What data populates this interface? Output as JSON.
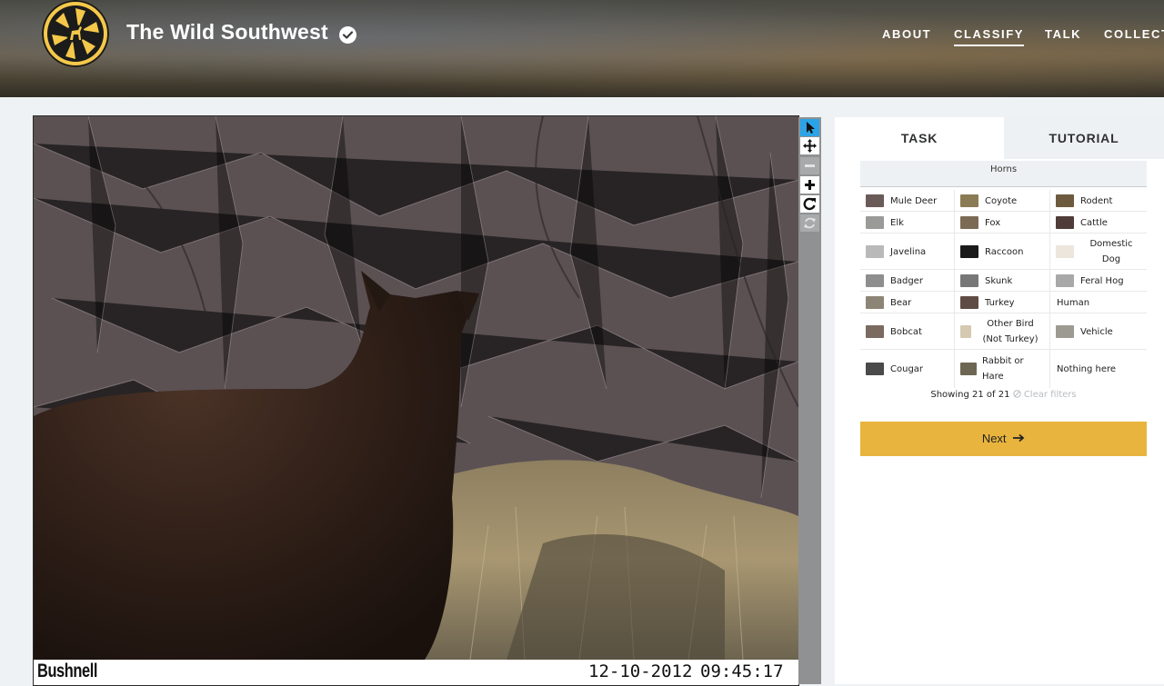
{
  "header": {
    "site_title": "The Wild Southwest",
    "nav": [
      {
        "label": "ABOUT",
        "active": false
      },
      {
        "label": "CLASSIFY",
        "active": true
      },
      {
        "label": "TALK",
        "active": false
      },
      {
        "label": "COLLECT",
        "active": false
      }
    ]
  },
  "viewer": {
    "camera_brand": "Bushnell",
    "date": "12-10-2012",
    "time": "09:45:17",
    "tools": [
      {
        "name": "pointer-icon",
        "state": "active"
      },
      {
        "name": "move-icon",
        "state": "enabled"
      },
      {
        "name": "zoom-out-icon",
        "state": "disabled"
      },
      {
        "name": "zoom-in-icon",
        "state": "enabled"
      },
      {
        "name": "rotate-icon",
        "state": "enabled"
      },
      {
        "name": "reset-icon",
        "state": "disabled"
      }
    ]
  },
  "task_panel": {
    "tabs": [
      "TASK",
      "TUTORIAL"
    ],
    "active_tab": "TASK",
    "filter_label": "Horns",
    "choices": [
      [
        "Mule Deer",
        "Coyote",
        "Rodent"
      ],
      [
        "Elk",
        "Fox",
        "Cattle"
      ],
      [
        "Javelina",
        "Raccoon",
        "Domestic Dog"
      ],
      [
        "Badger",
        "Skunk",
        "Feral Hog"
      ],
      [
        "Bear",
        "Turkey",
        "Human"
      ],
      [
        "Bobcat",
        "Other Bird (Not Turkey)",
        "Vehicle"
      ],
      [
        "Cougar",
        "Rabbit or Hare",
        "Nothing here"
      ]
    ],
    "showing_text": "Showing 21 of 21",
    "clear_filters": "Clear filters",
    "next_label": "Next",
    "next_color": "#e8b43d"
  },
  "colors": {
    "accent": "#e8b43d",
    "active_tool": "#2aa4e6",
    "logo": "#f4c84a"
  }
}
